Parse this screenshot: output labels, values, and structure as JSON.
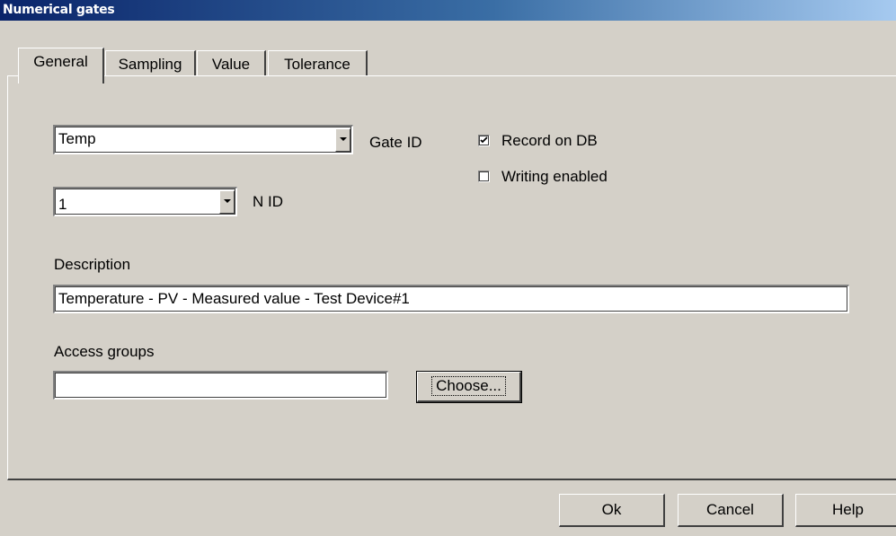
{
  "window": {
    "title": "Numerical gates"
  },
  "tabs": [
    {
      "label": "General",
      "active": true
    },
    {
      "label": "Sampling",
      "active": false
    },
    {
      "label": "Value",
      "active": false
    },
    {
      "label": "Tolerance",
      "active": false
    }
  ],
  "general": {
    "gate_id": {
      "value": "Temp",
      "label": "Gate ID"
    },
    "n_id": {
      "value": "1",
      "label": "N ID"
    },
    "record_on_db": {
      "label": "Record on DB",
      "checked": true
    },
    "writing_enabled": {
      "label": "Writing enabled",
      "checked": false
    },
    "description": {
      "label": "Description",
      "value": "Temperature - PV - Measured value - Test Device#1"
    },
    "access_groups": {
      "label": "Access groups",
      "value": "",
      "choose_label": "Choose..."
    }
  },
  "footer": {
    "ok_label": "Ok",
    "cancel_label": "Cancel",
    "help_label": "Help"
  },
  "colors": {
    "face": "#d4d0c8",
    "title_start": "#0a246a",
    "title_end": "#a6caf0"
  }
}
